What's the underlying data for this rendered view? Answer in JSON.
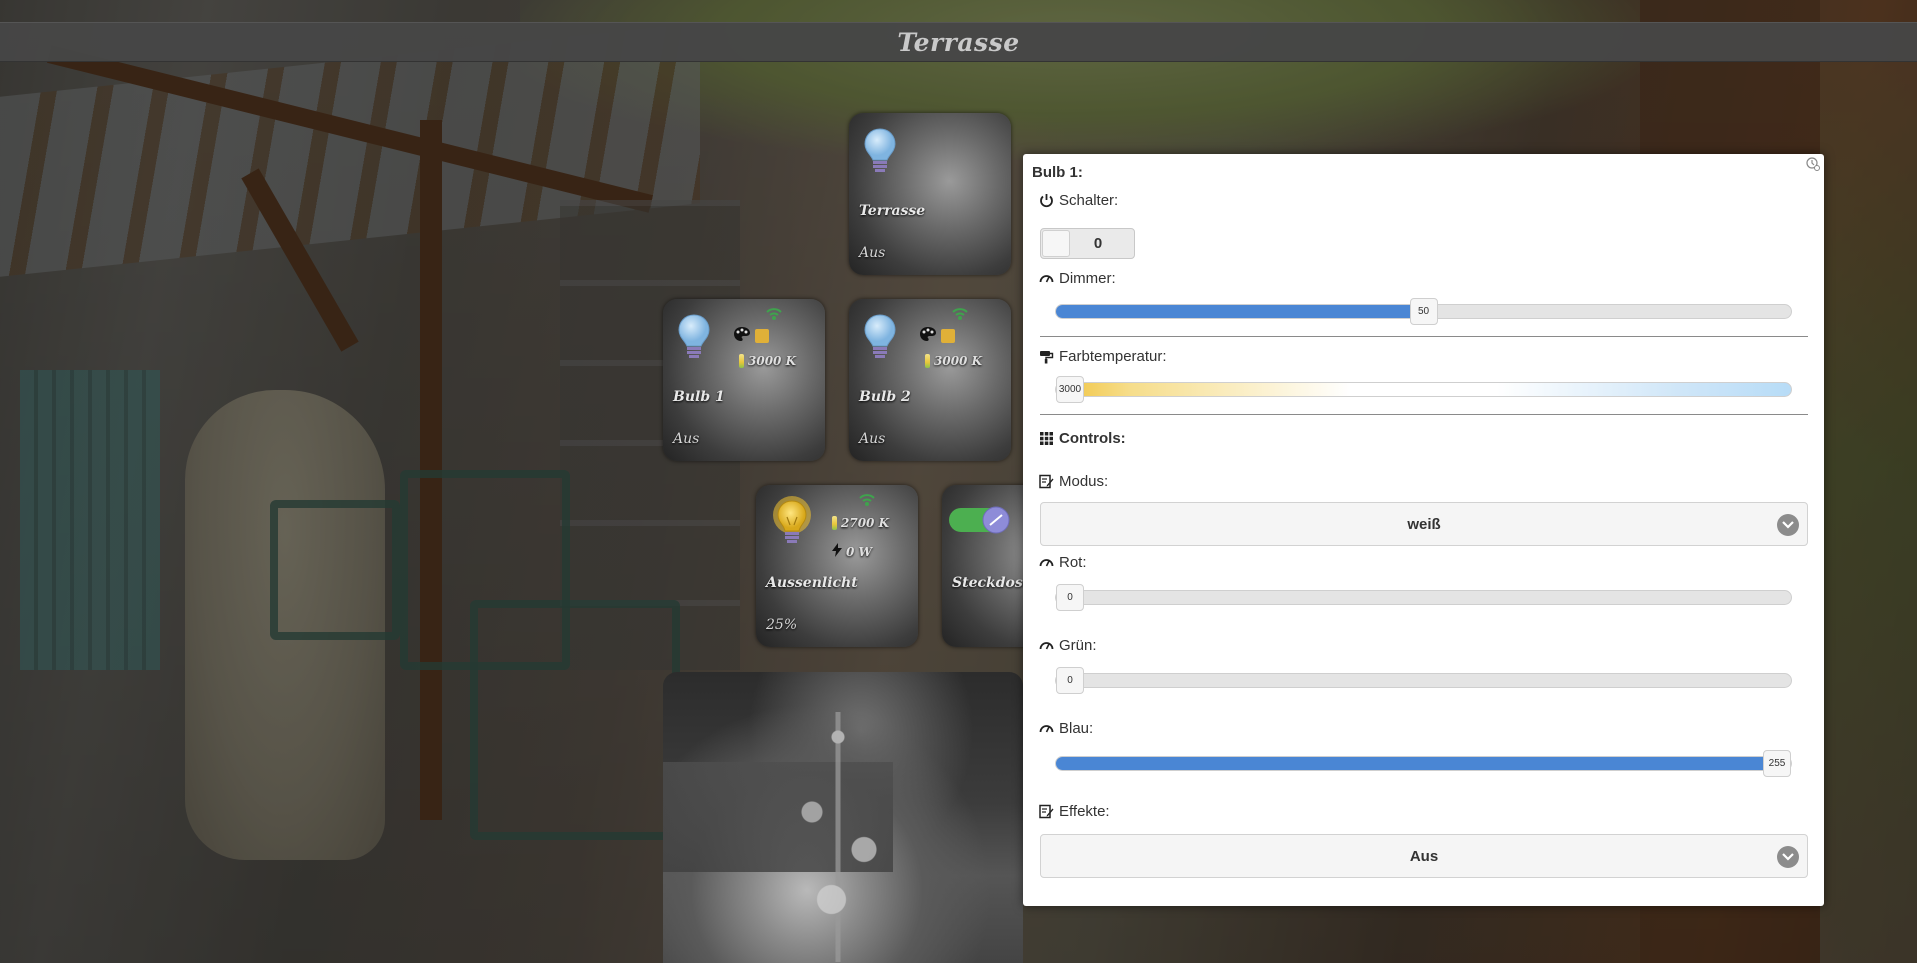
{
  "page": {
    "title": "Terrasse"
  },
  "tiles": [
    {
      "id": "terrasse",
      "name": "Terrasse",
      "state": "Aus",
      "icon": "lightbulb-off-icon"
    },
    {
      "id": "bulb1",
      "name": "Bulb 1",
      "state": "Aus",
      "temperature": "3000 K",
      "icon": "lightbulb-off-icon"
    },
    {
      "id": "bulb2",
      "name": "Bulb 2",
      "state": "Aus",
      "temperature": "3000 K",
      "icon": "lightbulb-off-icon"
    },
    {
      "id": "aussenlicht",
      "name": "Aussenlicht",
      "state": "25%",
      "temperature": "2700 K",
      "power": "0 W",
      "icon": "lightbulb-on-icon"
    },
    {
      "id": "steckdose",
      "name": "Steckdose",
      "icon": "toggle-switch-icon"
    }
  ],
  "dialog": {
    "title": "Bulb 1:",
    "schalter": {
      "label": "Schalter:",
      "value": "0"
    },
    "dimmer": {
      "label": "Dimmer:",
      "value": 50,
      "min": 0,
      "max": 100,
      "display": "50"
    },
    "farbtemperatur": {
      "label": "Farbtemperatur:",
      "value": 3000,
      "display": "3000"
    },
    "controls": {
      "label": "Controls:"
    },
    "modus": {
      "label": "Modus:",
      "selected": "weiß"
    },
    "rot": {
      "label": "Rot:",
      "value": 0,
      "max": 255,
      "display": "0"
    },
    "gruen": {
      "label": "Grün:",
      "value": 0,
      "max": 255,
      "display": "0"
    },
    "blau": {
      "label": "Blau:",
      "value": 255,
      "max": 255,
      "display": "255"
    },
    "effekte": {
      "label": "Effekte:",
      "selected": "Aus"
    }
  },
  "colors": {
    "accent": "#4a86d4",
    "header_bg": "#464646",
    "tile_text": "#e8e8e8"
  }
}
